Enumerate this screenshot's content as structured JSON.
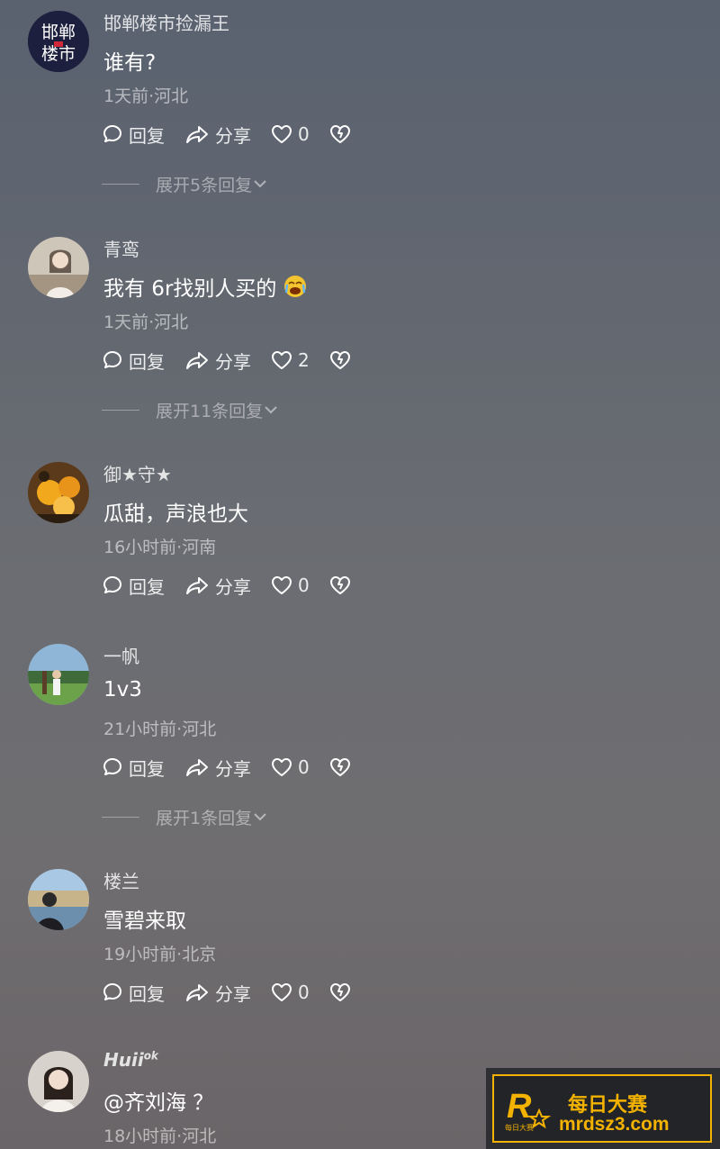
{
  "comments": [
    {
      "username": "邯郸楼市捡漏王",
      "avatar_text_line1": "邯郸",
      "avatar_text_line2": "楼市",
      "text": "谁有?",
      "meta": "1天前·河北",
      "reply_label": "回复",
      "share_label": "分享",
      "like_count": "0",
      "expand_text": "展开5条回复"
    },
    {
      "username": "青鸾",
      "text": "我有 6r找别人买的",
      "emoji": "😭",
      "meta": "1天前·河北",
      "reply_label": "回复",
      "share_label": "分享",
      "like_count": "2",
      "expand_text": "展开11条回复"
    },
    {
      "username": "御★守★",
      "text": "瓜甜，声浪也大",
      "meta": "16小时前·河南",
      "reply_label": "回复",
      "share_label": "分享",
      "like_count": "0"
    },
    {
      "username": "一帆",
      "text": "1v3",
      "meta": "21小时前·河北",
      "reply_label": "回复",
      "share_label": "分享",
      "like_count": "0",
      "expand_text": "展开1条回复"
    },
    {
      "username": "楼兰",
      "text": "雪碧来取",
      "meta": "19小时前·北京",
      "reply_label": "回复",
      "share_label": "分享",
      "like_count": "0"
    },
    {
      "username": "Huii",
      "username_badge": "ok",
      "text": "@齐刘海 ？",
      "meta": "18小时前·河北"
    }
  ],
  "watermark": {
    "title": "每日大赛",
    "url": "mrdsz3.com",
    "logo_letter": "R",
    "logo_caption": "每日大赛"
  },
  "colors": {
    "accent": "#f3b200",
    "text_primary": "#ffffff",
    "text_secondary": "rgba(255,255,255,0.55)"
  },
  "icons": {
    "reply": "comment-bubble-icon",
    "share": "share-arrow-icon",
    "like": "heart-icon",
    "dislike": "broken-heart-icon",
    "expand": "chevron-down-icon"
  }
}
